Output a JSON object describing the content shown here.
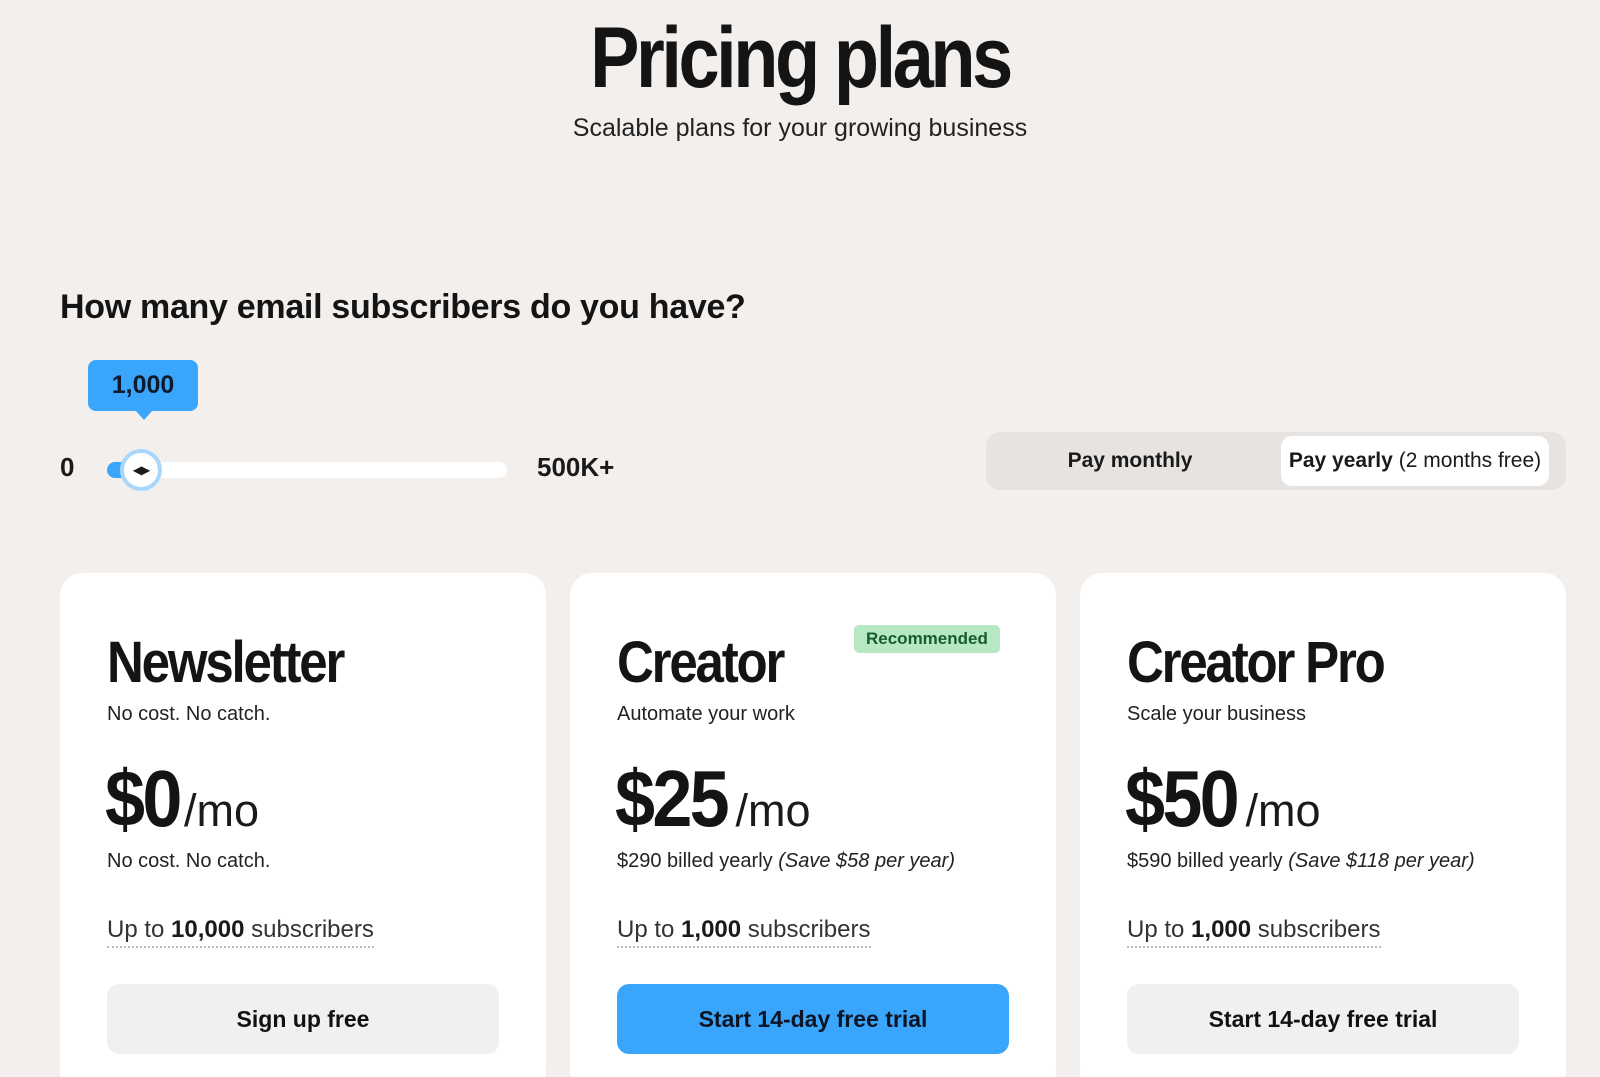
{
  "hero": {
    "title": "Pricing plans",
    "subtitle": "Scalable plans for your growing business"
  },
  "subscribers": {
    "question": "How many email subscribers do you have?",
    "value_label": "1,000",
    "min_label": "0",
    "max_label": "500K+",
    "slider_fraction": 0.002
  },
  "billing": {
    "monthly_label": "Pay monthly",
    "yearly_label": "Pay yearly",
    "yearly_note": "(2 months free)",
    "selected": "yearly"
  },
  "plans": [
    {
      "name": "Newsletter",
      "tagline": "No cost. No catch.",
      "price": "$0",
      "unit": "/mo",
      "billed": "No cost. No catch.",
      "save": "",
      "subs_prefix": "Up to",
      "subs_count": "10,000",
      "subs_suffix": "subscribers",
      "cta": "Sign up free"
    },
    {
      "name": "Creator",
      "badge": "Recommended",
      "tagline": "Automate your work",
      "price": "$25",
      "unit": "/mo",
      "billed": "$290 billed yearly",
      "save": "(Save $58 per year)",
      "subs_prefix": "Up to",
      "subs_count": "1,000",
      "subs_suffix": "subscribers",
      "cta": "Start 14-day free trial"
    },
    {
      "name": "Creator Pro",
      "tagline": "Scale your business",
      "price": "$50",
      "unit": "/mo",
      "billed": "$590 billed yearly",
      "save": "(Save $118 per year)",
      "subs_prefix": "Up to",
      "subs_count": "1,000",
      "subs_suffix": "subscribers",
      "cta": "Start 14-day free trial"
    }
  ],
  "colors": {
    "background": "#f2efed",
    "accent": "#3aa6fb",
    "badge_bg": "#b6e8c4",
    "badge_text": "#175c2c",
    "card": "#ffffff"
  },
  "icons": {
    "slider_thumb": "left-right-arrows-icon"
  }
}
